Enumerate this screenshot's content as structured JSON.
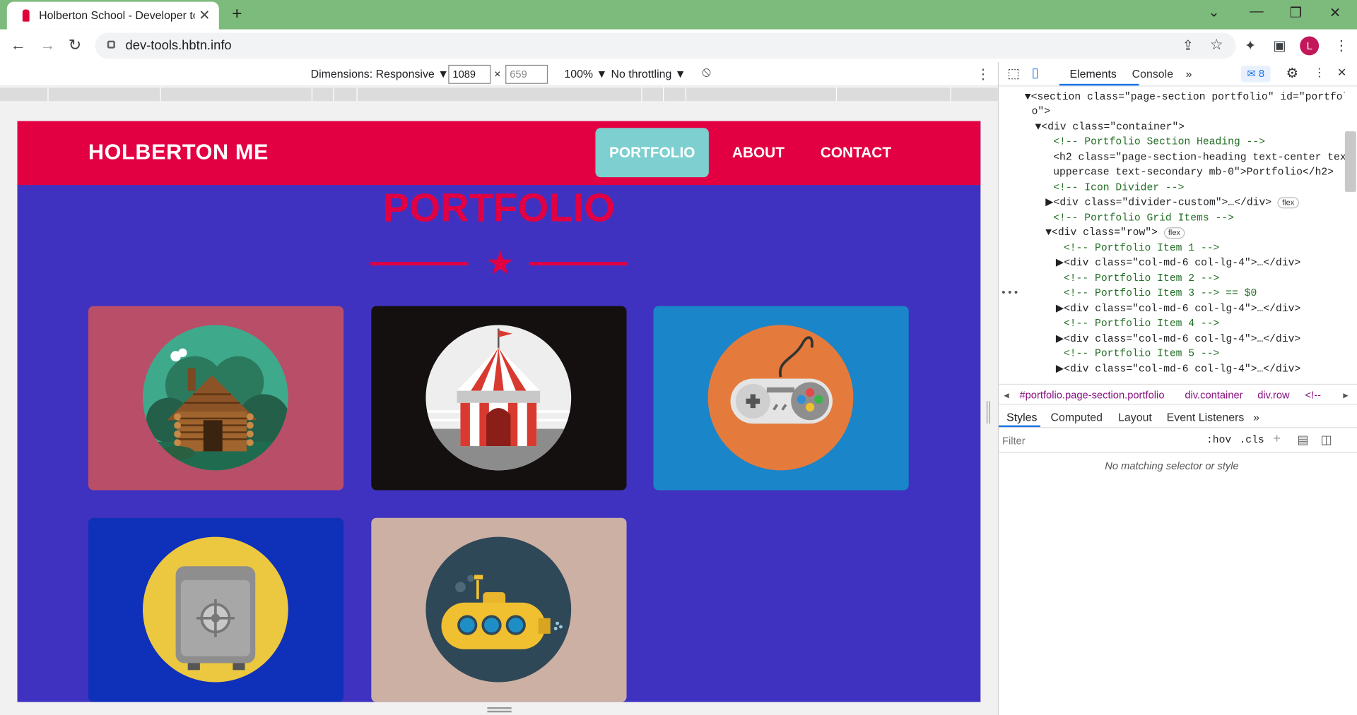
{
  "browser": {
    "tab_title": "Holberton School - Developer to",
    "tab_close": "✕",
    "new_tab": "+",
    "url": "dev-tools.hbtn.info",
    "avatar_letter": "L",
    "window_controls": [
      "⌄",
      "—",
      "❐",
      "✕"
    ]
  },
  "device_toolbar": {
    "dimensions_label": "Dimensions: Responsive ▼",
    "width": "1089",
    "times": "×",
    "height_placeholder": "659",
    "zoom": "100% ▼",
    "throttling": "No throttling ▼"
  },
  "site": {
    "brand": "HOLBERTON ME",
    "nav": [
      "PORTFOLIO",
      "ABOUT",
      "CONTACT"
    ],
    "active_nav": "PORTFOLIO",
    "heading": "PORTFOLIO",
    "colors": {
      "navbar": "#e20043",
      "background": "#4032c0",
      "active": "#7ecfd0",
      "accent": "#e20043"
    },
    "portfolio_items": [
      {
        "name": "cabin",
        "bg": "#b84e68",
        "circle": "#3fa98c"
      },
      {
        "name": "circus",
        "bg": "#141010",
        "circle": "#eeeeee"
      },
      {
        "name": "game",
        "bg": "#1a85c8",
        "circle": "#e47b3c"
      },
      {
        "name": "safe",
        "bg": "#0f30b8",
        "circle": "#ecc840"
      },
      {
        "name": "submarine",
        "bg": "#cdb0a4",
        "circle": "#2f4858"
      }
    ]
  },
  "devtools": {
    "tabs": [
      "Elements",
      "Console",
      "»"
    ],
    "badge": "8",
    "dom": [
      {
        "html": "▼<section class=\"page-section portfolio\" id=\"portfoli"
      },
      {
        "html": "o\">"
      },
      {
        "html": "▼<div class=\"container\">"
      },
      {
        "html": "<!-- Portfolio Section Heading -->"
      },
      {
        "html": "<h2 class=\"page-section-heading text-center text-"
      },
      {
        "html": "uppercase text-secondary mb-0\">Portfolio</h2>"
      },
      {
        "html": "<!-- Icon Divider -->"
      },
      {
        "html": "▶<div class=\"divider-custom\">…</div>"
      },
      {
        "html": "<!-- Portfolio Grid Items -->"
      },
      {
        "html": "▼<div class=\"row\">"
      },
      {
        "html": "<!-- Portfolio Item 1 -->"
      },
      {
        "html": "▶<div class=\"col-md-6 col-lg-4\">…</div>"
      },
      {
        "html": "<!-- Portfolio Item 2 -->"
      },
      {
        "html": "<!-- Portfolio Item 3 --> == $0"
      },
      {
        "html": "▶<div class=\"col-md-6 col-lg-4\">…</div>"
      },
      {
        "html": "<!-- Portfolio Item 4 -->"
      },
      {
        "html": "▶<div class=\"col-md-6 col-lg-4\">…</div>"
      },
      {
        "html": "<!-- Portfolio Item 5 -->"
      },
      {
        "html": "▶<div class=\"col-md-6 col-lg-4\">…</div>"
      }
    ],
    "pill_flex": "flex",
    "breadcrumbs": [
      "#portfolio.page-section.portfolio",
      "div.container",
      "div.row",
      "<!--"
    ],
    "style_tabs": [
      "Styles",
      "Computed",
      "Layout",
      "Event Listeners",
      "»"
    ],
    "filter_placeholder": "Filter",
    "hov": ":hov",
    "cls": ".cls",
    "no_match": "No matching selector or style"
  }
}
